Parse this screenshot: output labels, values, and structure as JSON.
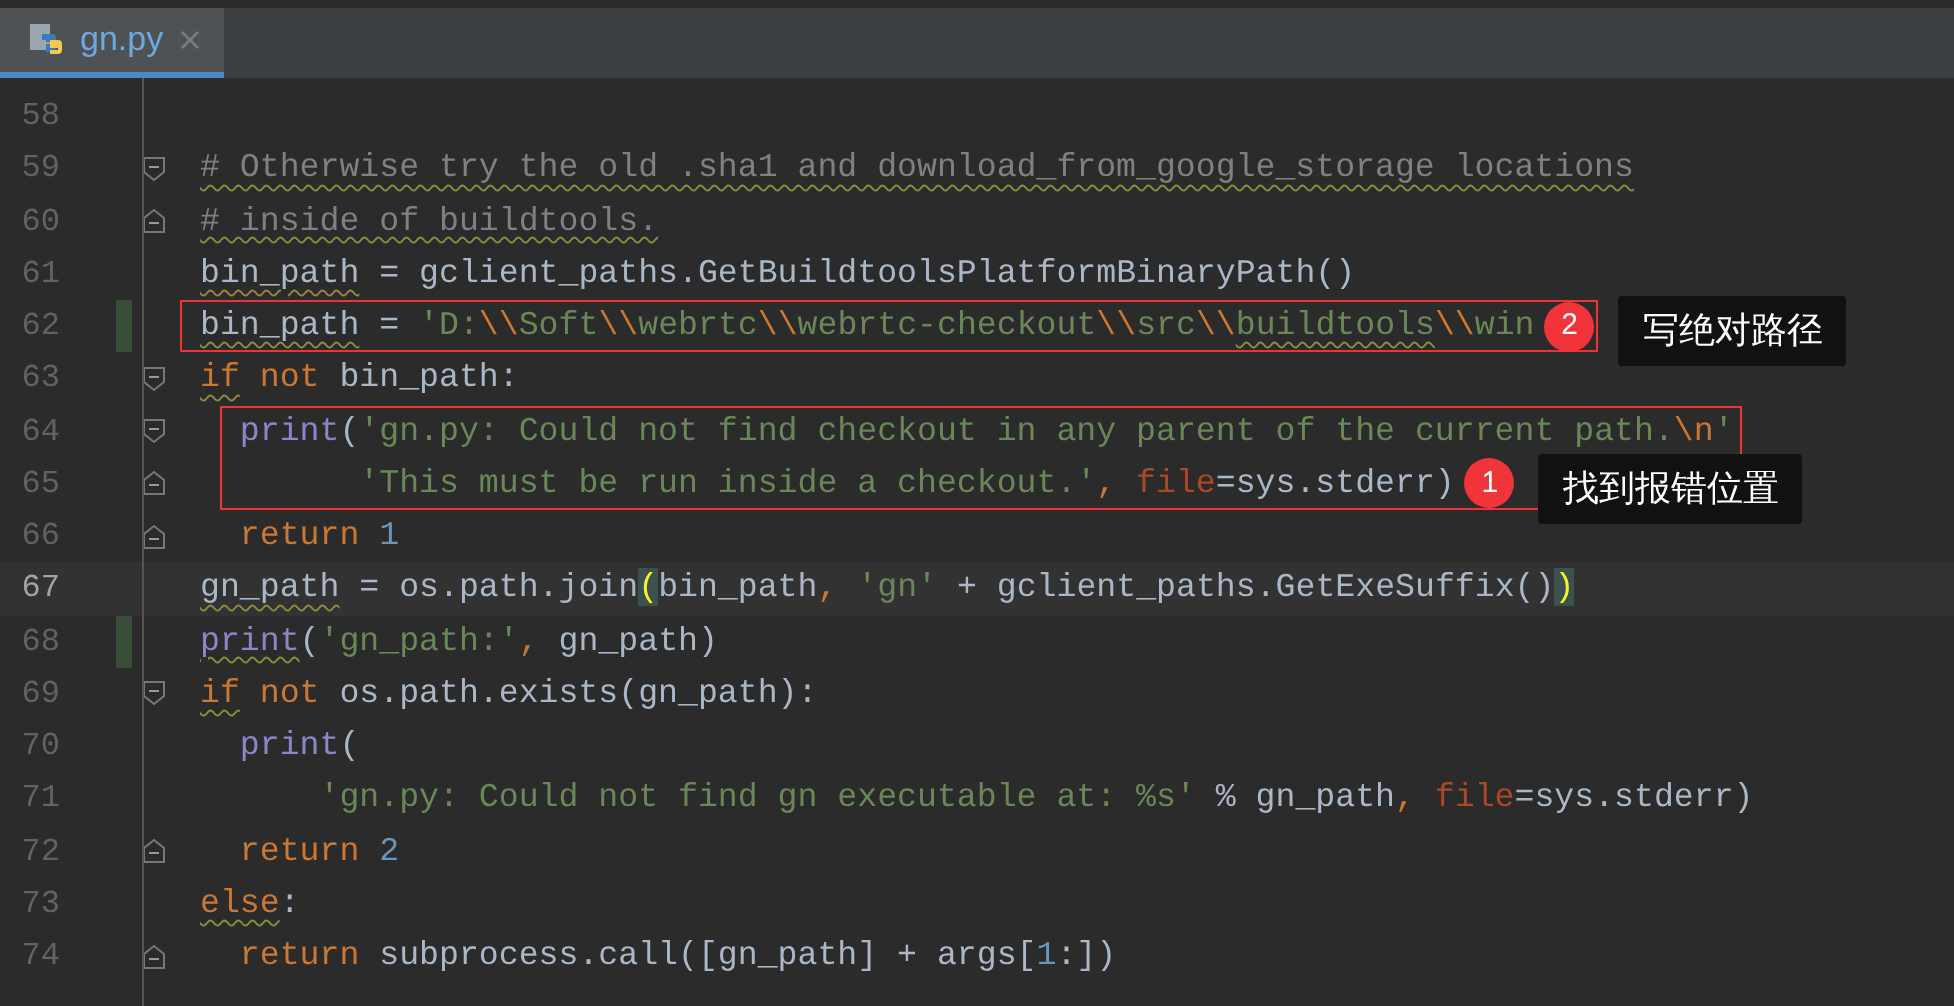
{
  "tabs": [
    {
      "label": "gn.py",
      "selected": true
    }
  ],
  "lines": [
    {
      "number": "58"
    },
    {
      "number": "59",
      "fold_start": true,
      "tokens": [
        {
          "kind": "comment",
          "text": "# Otherwise try the old .sha1 and download_from_google_storage locations",
          "wavy": true
        }
      ]
    },
    {
      "number": "60",
      "fold_end": true,
      "tokens": [
        {
          "kind": "comment",
          "text": "# inside of buildtools.",
          "wavy": true
        }
      ]
    },
    {
      "number": "61",
      "tokens": [
        {
          "kind": "plain",
          "text": "bin_path",
          "wavy": true
        },
        {
          "kind": "plain",
          "text": " = gclient_paths.GetBuildtoolsPlatformBinaryPath()"
        }
      ]
    },
    {
      "number": "62",
      "changed": true,
      "boxed": true,
      "tokens": [
        {
          "kind": "plain",
          "text": "bin_path",
          "wavy": true
        },
        {
          "kind": "plain",
          "text": " = "
        },
        {
          "kind": "string",
          "text": "'D:"
        },
        {
          "kind": "escape",
          "text": "\\\\"
        },
        {
          "kind": "string",
          "text": "Soft"
        },
        {
          "kind": "escape",
          "text": "\\\\"
        },
        {
          "kind": "string",
          "text": "webrtc"
        },
        {
          "kind": "escape",
          "text": "\\\\"
        },
        {
          "kind": "string",
          "text": "webrtc-checkout"
        },
        {
          "kind": "escape",
          "text": "\\\\"
        },
        {
          "kind": "string",
          "text": "src"
        },
        {
          "kind": "escape",
          "text": "\\\\"
        },
        {
          "kind": "string",
          "text": "buildtools",
          "wavy": true
        },
        {
          "kind": "escape",
          "text": "\\\\"
        },
        {
          "kind": "string",
          "text": "win"
        }
      ]
    },
    {
      "number": "63",
      "fold_start": true,
      "tokens": [
        {
          "kind": "keyword",
          "text": "if",
          "wavy": true
        },
        {
          "kind": "keyword",
          "text": " not"
        },
        {
          "kind": "plain",
          "text": " bin_path:"
        }
      ]
    },
    {
      "number": "64",
      "fold_start": true,
      "boxed": true,
      "tokens": [
        {
          "kind": "builtin",
          "text": "  print"
        },
        {
          "kind": "plain",
          "text": "("
        },
        {
          "kind": "string",
          "text": "'gn.py: Could not find checkout in any parent of the current path."
        },
        {
          "kind": "escape",
          "text": "\\n"
        },
        {
          "kind": "string",
          "text": "'"
        }
      ]
    },
    {
      "number": "65",
      "fold_end": true,
      "boxed": true,
      "tokens": [
        {
          "kind": "string",
          "text": "        'This must be run inside a checkout.'"
        },
        {
          "kind": "keyword",
          "text": ", "
        },
        {
          "kind": "param",
          "text": "file"
        },
        {
          "kind": "plain",
          "text": "=sys.stderr)"
        }
      ]
    },
    {
      "number": "66",
      "fold_end": true,
      "tokens": [
        {
          "kind": "keyword",
          "text": "  return"
        },
        {
          "kind": "number",
          "text": " 1"
        }
      ]
    },
    {
      "number": "67",
      "current": true,
      "tokens": [
        {
          "kind": "plain",
          "text": "gn_path",
          "wavy": true
        },
        {
          "kind": "plain",
          "text": " = os.path.join"
        },
        {
          "kind": "match",
          "text": "("
        },
        {
          "kind": "plain",
          "text": "bin_path"
        },
        {
          "kind": "keyword",
          "text": ", "
        },
        {
          "kind": "string",
          "text": "'gn'"
        },
        {
          "kind": "plain",
          "text": " + gclient_paths.GetExeSuffix()"
        },
        {
          "kind": "match",
          "text": ")"
        }
      ]
    },
    {
      "number": "68",
      "changed": true,
      "tokens": [
        {
          "kind": "builtin",
          "text": "print",
          "wavy": true
        },
        {
          "kind": "plain",
          "text": "("
        },
        {
          "kind": "string",
          "text": "'gn_path:'"
        },
        {
          "kind": "keyword",
          "text": ", "
        },
        {
          "kind": "plain",
          "text": "gn_path)"
        }
      ]
    },
    {
      "number": "69",
      "fold_start": true,
      "tokens": [
        {
          "kind": "keyword",
          "text": "if",
          "wavy": true
        },
        {
          "kind": "keyword",
          "text": " not"
        },
        {
          "kind": "plain",
          "text": " os.path.exists(gn_path):"
        }
      ]
    },
    {
      "number": "70",
      "tokens": [
        {
          "kind": "builtin",
          "text": "  print"
        },
        {
          "kind": "plain",
          "text": "("
        }
      ]
    },
    {
      "number": "71",
      "tokens": [
        {
          "kind": "string",
          "text": "      'gn.py: Could not find gn executable at: %s'"
        },
        {
          "kind": "plain",
          "text": " % gn_path"
        },
        {
          "kind": "keyword",
          "text": ", "
        },
        {
          "kind": "param",
          "text": "file"
        },
        {
          "kind": "plain",
          "text": "=sys.stderr)"
        }
      ]
    },
    {
      "number": "72",
      "fold_end": true,
      "tokens": [
        {
          "kind": "keyword",
          "text": "  return"
        },
        {
          "kind": "number",
          "text": " 2"
        }
      ]
    },
    {
      "number": "73",
      "tokens": [
        {
          "kind": "keyword",
          "text": "else",
          "wavy": true
        },
        {
          "kind": "plain",
          "text": ":"
        }
      ]
    },
    {
      "number": "74",
      "fold_end": true,
      "tokens": [
        {
          "kind": "keyword",
          "text": "  return"
        },
        {
          "kind": "plain",
          "text": " subprocess.call([gn_path] + args["
        },
        {
          "kind": "number",
          "text": "1"
        },
        {
          "kind": "plain",
          "text": ":])"
        }
      ]
    }
  ],
  "annotations": [
    {
      "number": "2",
      "text": "写绝对路径"
    },
    {
      "number": "1",
      "text": "找到报错位置"
    }
  ]
}
